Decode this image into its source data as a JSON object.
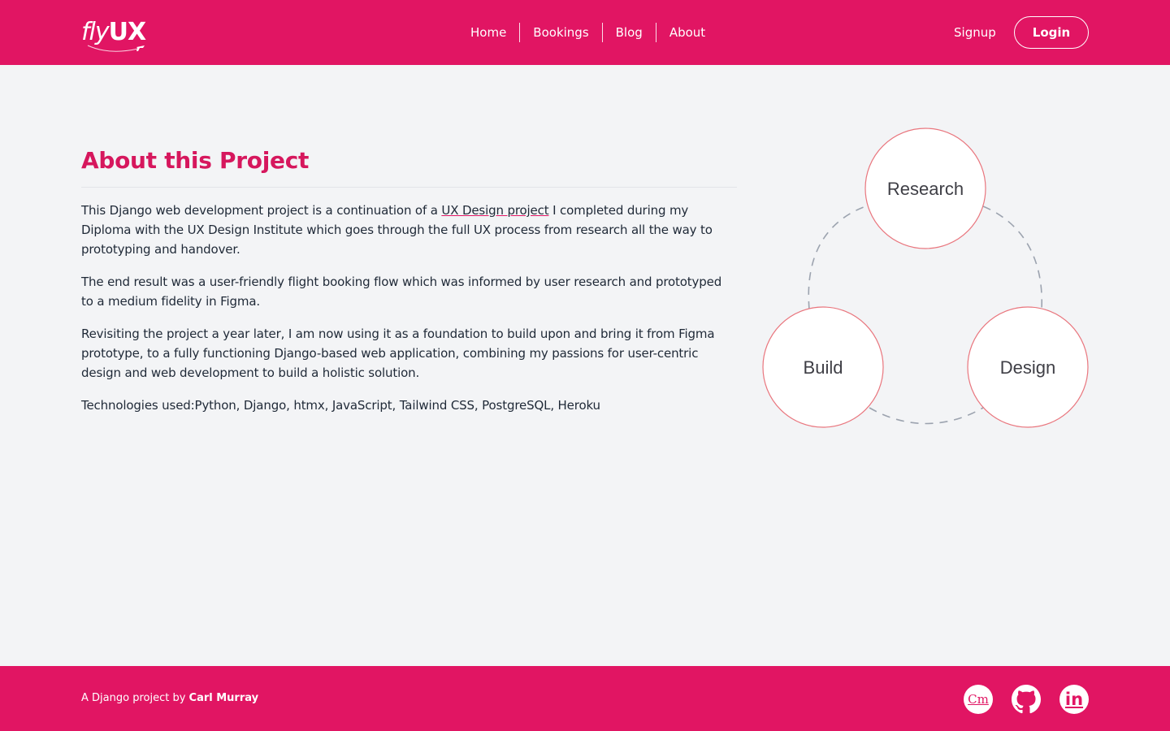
{
  "header": {
    "logo": {
      "part1": "fly",
      "part2": "UX"
    },
    "nav": [
      "Home",
      "Bookings",
      "Blog",
      "About"
    ],
    "signup_label": "Signup",
    "login_label": "Login"
  },
  "main": {
    "title": "About this Project",
    "paragraph1": {
      "before": "This Django web development project is a continuation of a ",
      "link": "UX Design project",
      "after": " I completed during my Diploma with the UX Design Institute which goes through the full UX process from research all the way to prototyping and handover."
    },
    "paragraph2": "The end result was a user-friendly flight booking flow which was informed by user research and prototyped to a medium fidelity in Figma.",
    "paragraph3": "Revisiting the project a year later, I am now using it as a foundation to build upon and bring it from Figma prototype, to a fully functioning Django-based web application, combining my passions for user-centric design and web development to build a holistic solution.",
    "technologies": "Technologies used:Python, Django, htmx, JavaScript, Tailwind CSS, PostgreSQL, Heroku"
  },
  "diagram": {
    "stages": [
      "Research",
      "Build",
      "Design"
    ],
    "accent": "#e9767e"
  },
  "footer": {
    "credit_prefix": "A Django project by ",
    "author": "Carl Murray",
    "social": [
      {
        "label": "Cm",
        "icon": "portfolio-icon"
      },
      {
        "label": "",
        "icon": "github-icon"
      },
      {
        "label": "in",
        "icon": "linkedin-icon"
      }
    ]
  },
  "colors": {
    "brand": "#e11563",
    "title": "#d6175d",
    "background": "#f3f4f6"
  }
}
